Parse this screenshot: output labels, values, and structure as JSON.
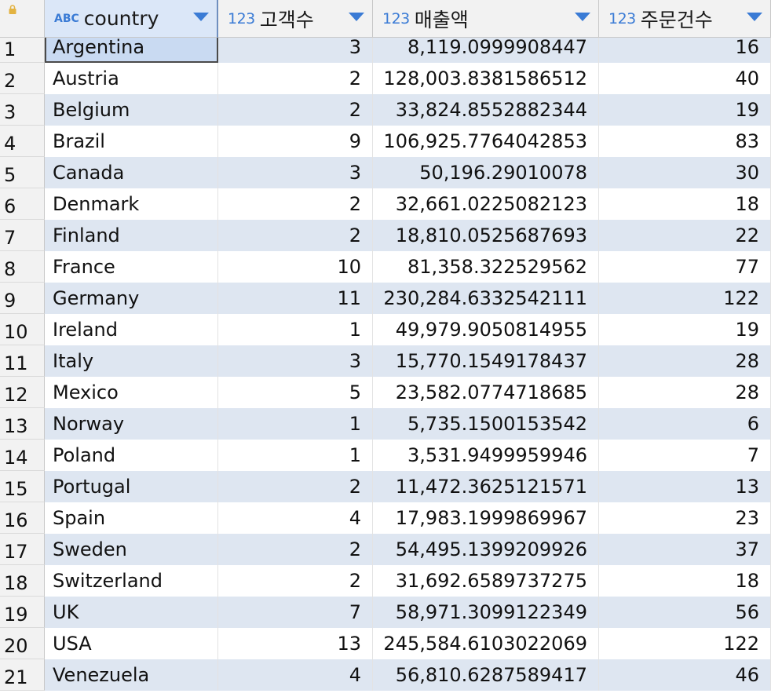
{
  "columns": [
    {
      "type": "ABC",
      "name": "country"
    },
    {
      "type": "123",
      "name": "고객수"
    },
    {
      "type": "123",
      "name": "매출액"
    },
    {
      "type": "123",
      "name": "주문건수"
    }
  ],
  "rows": [
    {
      "n": "1",
      "country": "Argentina",
      "customers": "3",
      "sales": "8,119.0999908447",
      "orders": "16"
    },
    {
      "n": "2",
      "country": "Austria",
      "customers": "2",
      "sales": "128,003.8381586512",
      "orders": "40"
    },
    {
      "n": "3",
      "country": "Belgium",
      "customers": "2",
      "sales": "33,824.8552882344",
      "orders": "19"
    },
    {
      "n": "4",
      "country": "Brazil",
      "customers": "9",
      "sales": "106,925.7764042853",
      "orders": "83"
    },
    {
      "n": "5",
      "country": "Canada",
      "customers": "3",
      "sales": "50,196.29010078",
      "orders": "30"
    },
    {
      "n": "6",
      "country": "Denmark",
      "customers": "2",
      "sales": "32,661.0225082123",
      "orders": "18"
    },
    {
      "n": "7",
      "country": "Finland",
      "customers": "2",
      "sales": "18,810.0525687693",
      "orders": "22"
    },
    {
      "n": "8",
      "country": "France",
      "customers": "10",
      "sales": "81,358.322529562",
      "orders": "77"
    },
    {
      "n": "9",
      "country": "Germany",
      "customers": "11",
      "sales": "230,284.6332542111",
      "orders": "122"
    },
    {
      "n": "10",
      "country": "Ireland",
      "customers": "1",
      "sales": "49,979.9050814955",
      "orders": "19"
    },
    {
      "n": "11",
      "country": "Italy",
      "customers": "3",
      "sales": "15,770.1549178437",
      "orders": "28"
    },
    {
      "n": "12",
      "country": "Mexico",
      "customers": "5",
      "sales": "23,582.0774718685",
      "orders": "28"
    },
    {
      "n": "13",
      "country": "Norway",
      "customers": "1",
      "sales": "5,735.1500153542",
      "orders": "6"
    },
    {
      "n": "14",
      "country": "Poland",
      "customers": "1",
      "sales": "3,531.9499959946",
      "orders": "7"
    },
    {
      "n": "15",
      "country": "Portugal",
      "customers": "2",
      "sales": "11,472.3625121571",
      "orders": "13"
    },
    {
      "n": "16",
      "country": "Spain",
      "customers": "4",
      "sales": "17,983.1999869967",
      "orders": "23"
    },
    {
      "n": "17",
      "country": "Sweden",
      "customers": "2",
      "sales": "54,495.1399209926",
      "orders": "37"
    },
    {
      "n": "18",
      "country": "Switzerland",
      "customers": "2",
      "sales": "31,692.6589737275",
      "orders": "18"
    },
    {
      "n": "19",
      "country": "UK",
      "customers": "7",
      "sales": "58,971.3099122349",
      "orders": "56"
    },
    {
      "n": "20",
      "country": "USA",
      "customers": "13",
      "sales": "245,584.6103022069",
      "orders": "122"
    },
    {
      "n": "21",
      "country": "Venezuela",
      "customers": "4",
      "sales": "56,810.6287589417",
      "orders": "46"
    }
  ],
  "selected_row_index": 0,
  "icons": {
    "corner": "lock-icon",
    "sort": "sort-arrow-icon"
  },
  "colors": {
    "accent": "#3a7bd5",
    "row_stripe": "#dee6f1",
    "selected_cell": "#c9daf2",
    "header_bg": "#f2f2f2"
  }
}
